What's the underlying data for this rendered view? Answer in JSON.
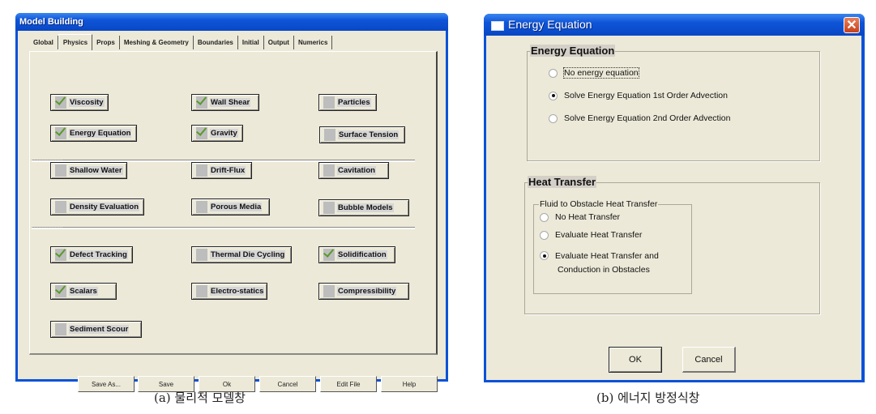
{
  "model_building": {
    "title": "Model Building",
    "tabs": [
      {
        "label": "Global",
        "active": false
      },
      {
        "label": "Physics",
        "active": true
      },
      {
        "label": "Props",
        "active": false
      },
      {
        "label": "Meshing & Geometry",
        "active": false
      },
      {
        "label": "Boundaries",
        "active": false
      },
      {
        "label": "Initial",
        "active": false
      },
      {
        "label": "Output",
        "active": false
      },
      {
        "label": "Numerics",
        "active": false
      }
    ],
    "physics_buttons": [
      {
        "label": "Viscosity",
        "checked": true
      },
      {
        "label": "Wall Shear",
        "checked": true
      },
      {
        "label": "Particles",
        "checked": false
      },
      {
        "label": "Energy Equation",
        "checked": true
      },
      {
        "label": "Gravity",
        "checked": true
      },
      {
        "label": "Surface Tension",
        "checked": false
      },
      {
        "label": "Shallow Water",
        "checked": false
      },
      {
        "label": "Drift-Flux",
        "checked": false
      },
      {
        "label": "Cavitation",
        "checked": false
      },
      {
        "label": "Density Evaluation",
        "checked": false
      },
      {
        "label": "Porous Media",
        "checked": false
      },
      {
        "label": "Bubble Models",
        "checked": false
      },
      {
        "label": "Defect Tracking",
        "checked": true
      },
      {
        "label": "Thermal Die Cycling",
        "checked": false
      },
      {
        "label": "Solidification",
        "checked": true
      },
      {
        "label": "Scalars",
        "checked": true
      },
      {
        "label": "Electro-statics",
        "checked": false
      },
      {
        "label": "Compressibility",
        "checked": false
      },
      {
        "label": "Sediment Scour",
        "checked": false
      }
    ],
    "footer_buttons": [
      "Save As...",
      "Save",
      "Ok",
      "Cancel",
      "Edit File",
      "Help"
    ]
  },
  "energy_dialog": {
    "title": "Energy Equation",
    "close_glyph": "✕",
    "energy_group": {
      "title": "Energy Equation",
      "options": [
        {
          "label": "No energy equation",
          "selected": false,
          "focused": true
        },
        {
          "label": "Solve Energy Equation 1st Order Advection",
          "selected": true,
          "focused": false
        },
        {
          "label": "Solve Energy Equation 2nd Order Advection",
          "selected": false,
          "focused": false
        }
      ]
    },
    "heat_group": {
      "title": "Heat Transfer",
      "subgroup_title": "Fluid to Obstacle Heat Transfer",
      "options": [
        {
          "label": "No Heat Transfer",
          "selected": false
        },
        {
          "label": "Evaluate Heat Transfer",
          "selected": false
        },
        {
          "label": "Evaluate Heat Transfer and",
          "label_line2": "Conduction in Obstacles",
          "selected": true
        }
      ]
    },
    "ok_label": "OK",
    "cancel_label": "Cancel"
  },
  "captions": {
    "a": "(a) 물리적 모델창",
    "b": "(b) 에너지 방정식창"
  }
}
